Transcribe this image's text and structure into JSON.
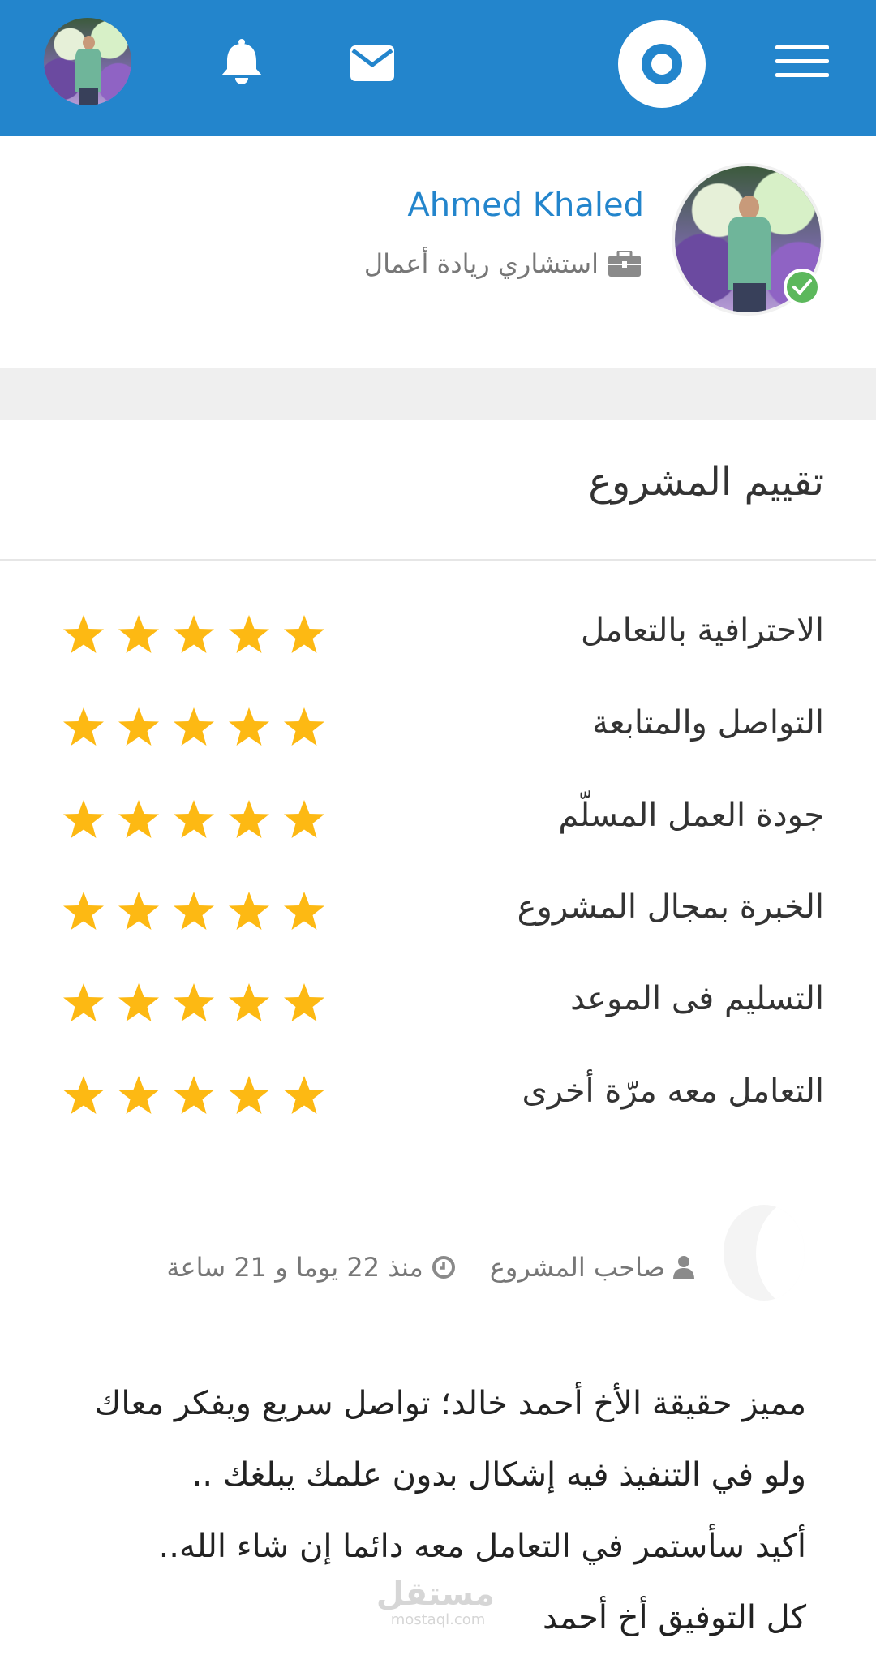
{
  "header": {
    "icons": [
      "menu-icon",
      "logo-icon",
      "mail-icon",
      "bell-icon",
      "avatar"
    ],
    "brand_color": "#2385cc"
  },
  "profile": {
    "name": "Ahmed Khaled",
    "title": "استشاري ريادة أعمال",
    "verified": true
  },
  "rating": {
    "title": "تقييم المشروع",
    "star_color": "#fdb913",
    "criteria": [
      {
        "label": "الاحترافية بالتعامل",
        "stars": 5
      },
      {
        "label": "التواصل والمتابعة",
        "stars": 5
      },
      {
        "label": "جودة العمل المسلّم",
        "stars": 5
      },
      {
        "label": "الخبرة بمجال المشروع",
        "stars": 5
      },
      {
        "label": "التسليم فى الموعد",
        "stars": 5
      },
      {
        "label": "التعامل معه مرّة أخرى",
        "stars": 5
      }
    ]
  },
  "review": {
    "author_role": "صاحب المشروع",
    "time_ago": "منذ 22 يوما و 21 ساعة",
    "lines": [
      "مميز حقيقة الأخ أحمد خالد؛ تواصل سريع ويفكر معاك",
      "ولو في التنفيذ فيه إشكال بدون علمك يبلغك ..",
      "أكيد سأستمر في التعامل معه دائما إن شاء الله..",
      "كل التوفيق أخ أحمد"
    ]
  },
  "watermark": {
    "arabic": "مستقل",
    "latin": "mostaql.com"
  }
}
